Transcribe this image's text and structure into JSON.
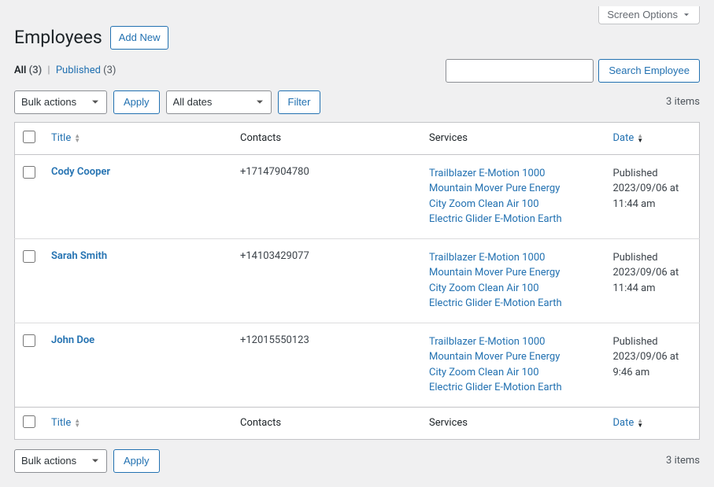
{
  "screen_options": "Screen Options",
  "page_title": "Employees",
  "add_new": "Add New",
  "views": {
    "all_label": "All",
    "all_count": "(3)",
    "published_label": "Published",
    "published_count": "(3)"
  },
  "search": {
    "button": "Search Employee"
  },
  "bulk_actions": "Bulk actions",
  "apply": "Apply",
  "all_dates": "All dates",
  "filter": "Filter",
  "items_count": "3 items",
  "columns": {
    "title": "Title",
    "contacts": "Contacts",
    "services": "Services",
    "date": "Date"
  },
  "rows": [
    {
      "title": "Cody Cooper",
      "contacts": "+17147904780",
      "services": [
        "Trailblazer E-Motion 1000",
        "Mountain Mover Pure Energy",
        "City Zoom Clean Air 100",
        "Electric Glider E-Motion Earth"
      ],
      "status": "Published",
      "date": "2023/09/06 at 11:44 am"
    },
    {
      "title": "Sarah Smith",
      "contacts": "+14103429077",
      "services": [
        "Trailblazer E-Motion 1000",
        "Mountain Mover Pure Energy",
        "City Zoom Clean Air 100",
        "Electric Glider E-Motion Earth"
      ],
      "status": "Published",
      "date": "2023/09/06 at 11:44 am"
    },
    {
      "title": "John Doe",
      "contacts": "+12015550123",
      "services": [
        "Trailblazer E-Motion 1000",
        "Mountain Mover Pure Energy",
        "City Zoom Clean Air 100",
        "Electric Glider E-Motion Earth"
      ],
      "status": "Published",
      "date": "2023/09/06 at 9:46 am"
    }
  ]
}
